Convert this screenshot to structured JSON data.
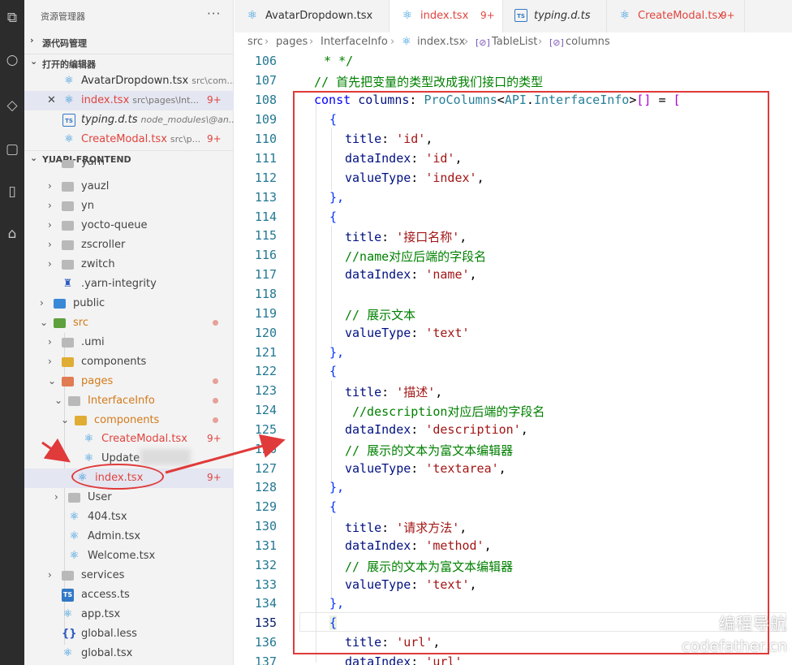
{
  "sidebar": {
    "title": "资源管理器",
    "more": "···",
    "sections": {
      "source_control": "源代码管理",
      "open_editors": "打开的编辑器",
      "project": "YUAPI-FRONTEND"
    },
    "open_editors": [
      {
        "name": "AvatarDropdown.tsx",
        "path": "src\\com...",
        "badge": ""
      },
      {
        "name": "index.tsx",
        "path": "src\\pages\\Int...",
        "badge": "9+"
      },
      {
        "name": "typing.d.ts",
        "path": "node_modules\\@an...",
        "badge": ""
      },
      {
        "name": "CreateModal.tsx",
        "path": "src\\p...",
        "badge": "9+"
      }
    ],
    "tree": [
      {
        "label": "yarn"
      },
      {
        "label": "yauzl"
      },
      {
        "label": "yn"
      },
      {
        "label": "yocto-queue"
      },
      {
        "label": "zscroller"
      },
      {
        "label": "zwitch"
      },
      {
        "label": ".yarn-integrity"
      },
      {
        "label": "public"
      },
      {
        "label": "src"
      },
      {
        "label": ".umi"
      },
      {
        "label": "components"
      },
      {
        "label": "pages"
      },
      {
        "label": "InterfaceInfo"
      },
      {
        "label": "components"
      },
      {
        "label": "CreateModal.tsx",
        "badge": "9+"
      },
      {
        "label": "Update"
      },
      {
        "label": "index.tsx",
        "badge": "9+"
      },
      {
        "label": "User"
      },
      {
        "label": "404.tsx"
      },
      {
        "label": "Admin.tsx"
      },
      {
        "label": "Welcome.tsx"
      },
      {
        "label": "services"
      },
      {
        "label": "access.ts"
      },
      {
        "label": "app.tsx"
      },
      {
        "label": "global.less"
      },
      {
        "label": "global.tsx"
      }
    ]
  },
  "tabs": [
    {
      "name": "AvatarDropdown.tsx",
      "badge": ""
    },
    {
      "name": "index.tsx",
      "badge": "9+"
    },
    {
      "name": "typing.d.ts",
      "badge": ""
    },
    {
      "name": "CreateModal.tsx",
      "badge": "9+"
    }
  ],
  "breadcrumb": [
    "src",
    "pages",
    "InterfaceInfo",
    "index.tsx",
    "TableList",
    "columns"
  ],
  "editor": {
    "line_numbers": [
      "106",
      "107",
      "108",
      "109",
      "110",
      "111",
      "112",
      "113",
      "114",
      "115",
      "116",
      "117",
      "118",
      "119",
      "120",
      "121",
      "122",
      "123",
      "124",
      "125",
      "126",
      "127",
      "128",
      "129",
      "130",
      "131",
      "132",
      "133",
      "134",
      "135",
      "136",
      "137"
    ],
    "tokens": {
      "l106": " * */",
      "l107": "// 首先把变量的类型改成我们接口的类型",
      "kw_const": "const",
      "var_columns": "columns",
      "colon": ":",
      "type_procolumns": "ProColumns",
      "lt": "<",
      "type_api": "API",
      "dot": ".",
      "type_interfaceinfo": "InterfaceInfo",
      "gt": ">",
      "arr": "[]",
      "eq": "=",
      "open_sq": "[",
      "open_brace": "{",
      "close_brace": "},",
      "k_title": "title",
      "k_dataIndex": "dataIndex",
      "k_valueType": "valueType",
      "s_id": "'id'",
      "s_index": "'index'",
      "s_name_cn": "'接口名称'",
      "c_name": "//name对应后端的字段名",
      "s_name": "'name'",
      "c_show_text": "// 展示文本",
      "s_text": "'text'",
      "s_desc_cn": "'描述'",
      "c_desc": "//description对应后端的字段名",
      "s_description": "'description'",
      "c_richtext": "// 展示的文本为富文本编辑器",
      "s_textarea": "'textarea'",
      "s_method_cn": "'请求方法'",
      "s_method": "'method'",
      "s_url": "'url'",
      "comma": ","
    }
  },
  "watermark": {
    "line1": "编程导航",
    "line2": "codefather.cn"
  },
  "colors": {
    "highlight": "#e03a3a",
    "keyword": "#0000ff",
    "string": "#a31515",
    "comment": "#008000"
  }
}
